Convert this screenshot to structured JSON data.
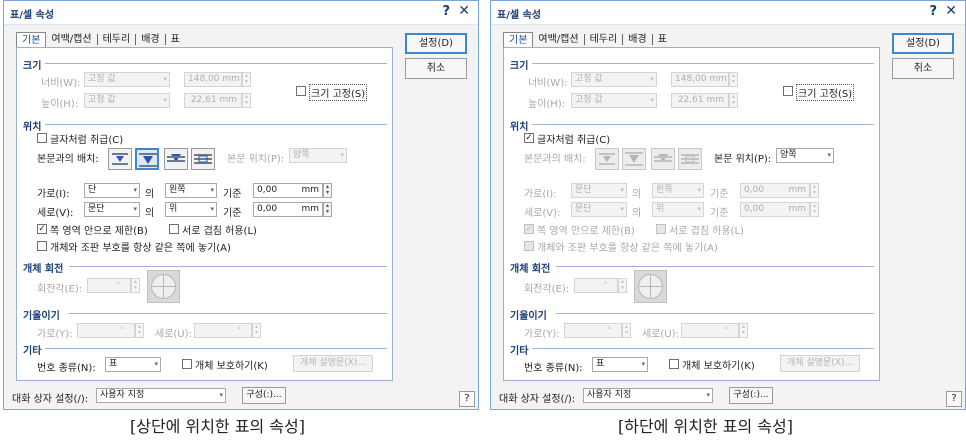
{
  "window": {
    "title": "표/셀 속성",
    "help_icon": "?",
    "close_icon": "✕"
  },
  "tabs": [
    "기본",
    "여백/캡션",
    "테두리",
    "배경",
    "표"
  ],
  "buttons": {
    "ok": "설정(D)",
    "cancel": "취소",
    "help": "?"
  },
  "size": {
    "header": "크기",
    "width_label": "너비(W):",
    "width_mode": "고정 값",
    "width_value": "148,00 mm",
    "height_label": "높이(H):",
    "height_mode": "고정 값",
    "height_value": "22,61 mm",
    "fix_size": "크기 고정(S)"
  },
  "position": {
    "header": "위치",
    "treat_as_char": "글자처럼 취급(C)",
    "wrap_label": "본문과의 배치:",
    "body_pos_label": "본문 위치(P):",
    "body_pos_value": "양쪽",
    "horiz_label": "가로(I):",
    "vert_label": "세로(V):",
    "of_text": "의",
    "ref_text": "기준",
    "mm": "mm",
    "limit": "쪽 영역 안으로 제한(B)",
    "overlap": "서로 겹침 허용(L)",
    "same_page": "개체와 조판 부호를 항상 같은 쪽에 놓기(A)"
  },
  "rotation": {
    "header": "개체 회전",
    "label": "회전각(E):"
  },
  "skew": {
    "header": "기울이기",
    "h_label": "가로(Y):",
    "v_label": "세로(U):"
  },
  "other": {
    "header": "기타",
    "number_label": "번호 종류(N):",
    "number_value": "표",
    "protect": "개체 보호하기(K)",
    "desc_button": "개체 설명문(X)..."
  },
  "dialog_settings": {
    "label": "대화 상자 설정(/):",
    "value": "사용자 지정",
    "button": "구성(:)..."
  },
  "dialogs": [
    {
      "treat_as_char": false,
      "horiz": {
        "ref": "단",
        "align": "왼쪽",
        "offset": "0,00"
      },
      "vert": {
        "ref": "문단",
        "align": "위",
        "offset": "0,00"
      },
      "limit_checked": true
    },
    {
      "treat_as_char": true,
      "horiz": {
        "ref": "문단",
        "align": "왼쪽",
        "offset": "0,00"
      },
      "vert": {
        "ref": "문단",
        "align": "위",
        "offset": "0,00"
      },
      "limit_checked": true
    }
  ],
  "captions": [
    "[상단에 위치한 표의 속성]",
    "[하단에 위치한 표의 속성]"
  ]
}
